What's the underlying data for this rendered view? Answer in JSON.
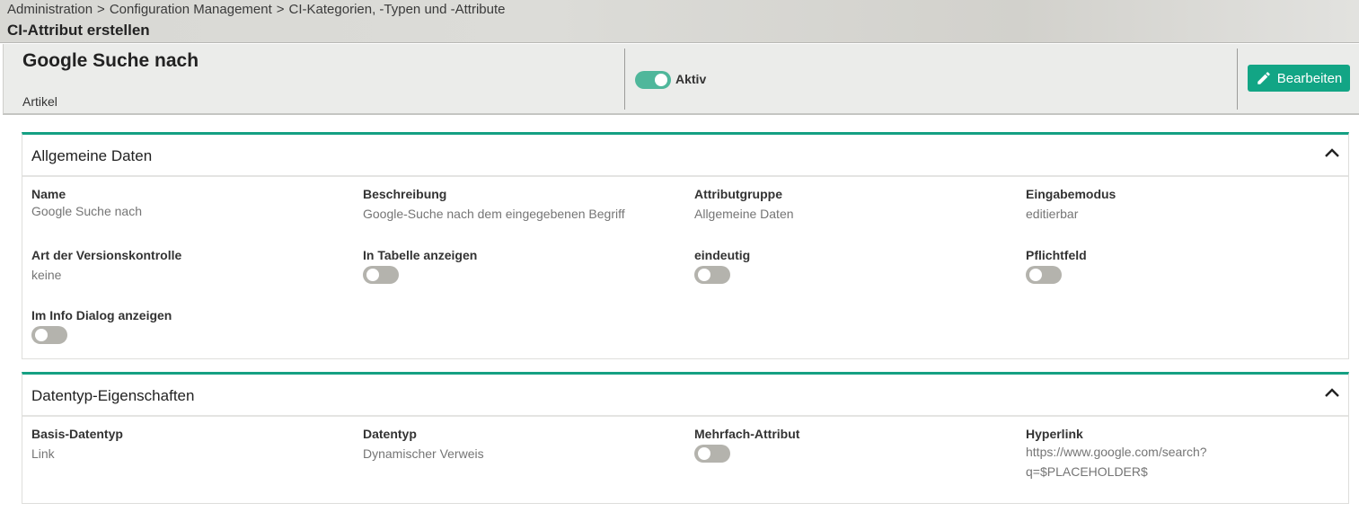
{
  "breadcrumb": {
    "items": [
      "Administration",
      "Configuration Management",
      "CI-Kategorien, -Typen und -Attribute"
    ],
    "separator": ">"
  },
  "page_title": "CI-Attribut erstellen",
  "header": {
    "title": "Google Suche nach",
    "subtitle": "Artikel",
    "active_label": "Aktiv",
    "active": true,
    "edit_label": "Bearbeiten"
  },
  "icons": {
    "edit": "pencil-icon",
    "collapse": "chevron-up-icon"
  },
  "colors": {
    "accent": "#12a585",
    "toggle_on": "#4fb79b",
    "toggle_off": "#b4b3ad"
  },
  "general": {
    "title": "Allgemeine Daten",
    "name_label": "Name",
    "name_value": "Google Suche nach",
    "description_label": "Beschreibung",
    "description_value": "Google-Suche nach dem eingegebenen Begriff",
    "group_label": "Attributgruppe",
    "group_value": "Allgemeine Daten",
    "input_mode_label": "Eingabemodus",
    "input_mode_value": "editierbar",
    "versioning_label": "Art der Versionskontrolle",
    "versioning_value": "keine",
    "show_in_table_label": "In Tabelle anzeigen",
    "show_in_table": false,
    "unique_label": "eindeutig",
    "unique": false,
    "required_label": "Pflichtfeld",
    "required": false,
    "info_dialog_label": "Im Info Dialog anzeigen",
    "info_dialog": false
  },
  "datatype": {
    "title": "Datentyp-Eigenschaften",
    "base_type_label": "Basis-Datentyp",
    "base_type_value": "Link",
    "type_label": "Datentyp",
    "type_value": "Dynamischer Verweis",
    "multi_label": "Mehrfach-Attribut",
    "multi": false,
    "hyperlink_label": "Hyperlink",
    "hyperlink_line1": "https://www.google.com/search?",
    "hyperlink_line2": "q=$PLACEHOLDER$"
  }
}
